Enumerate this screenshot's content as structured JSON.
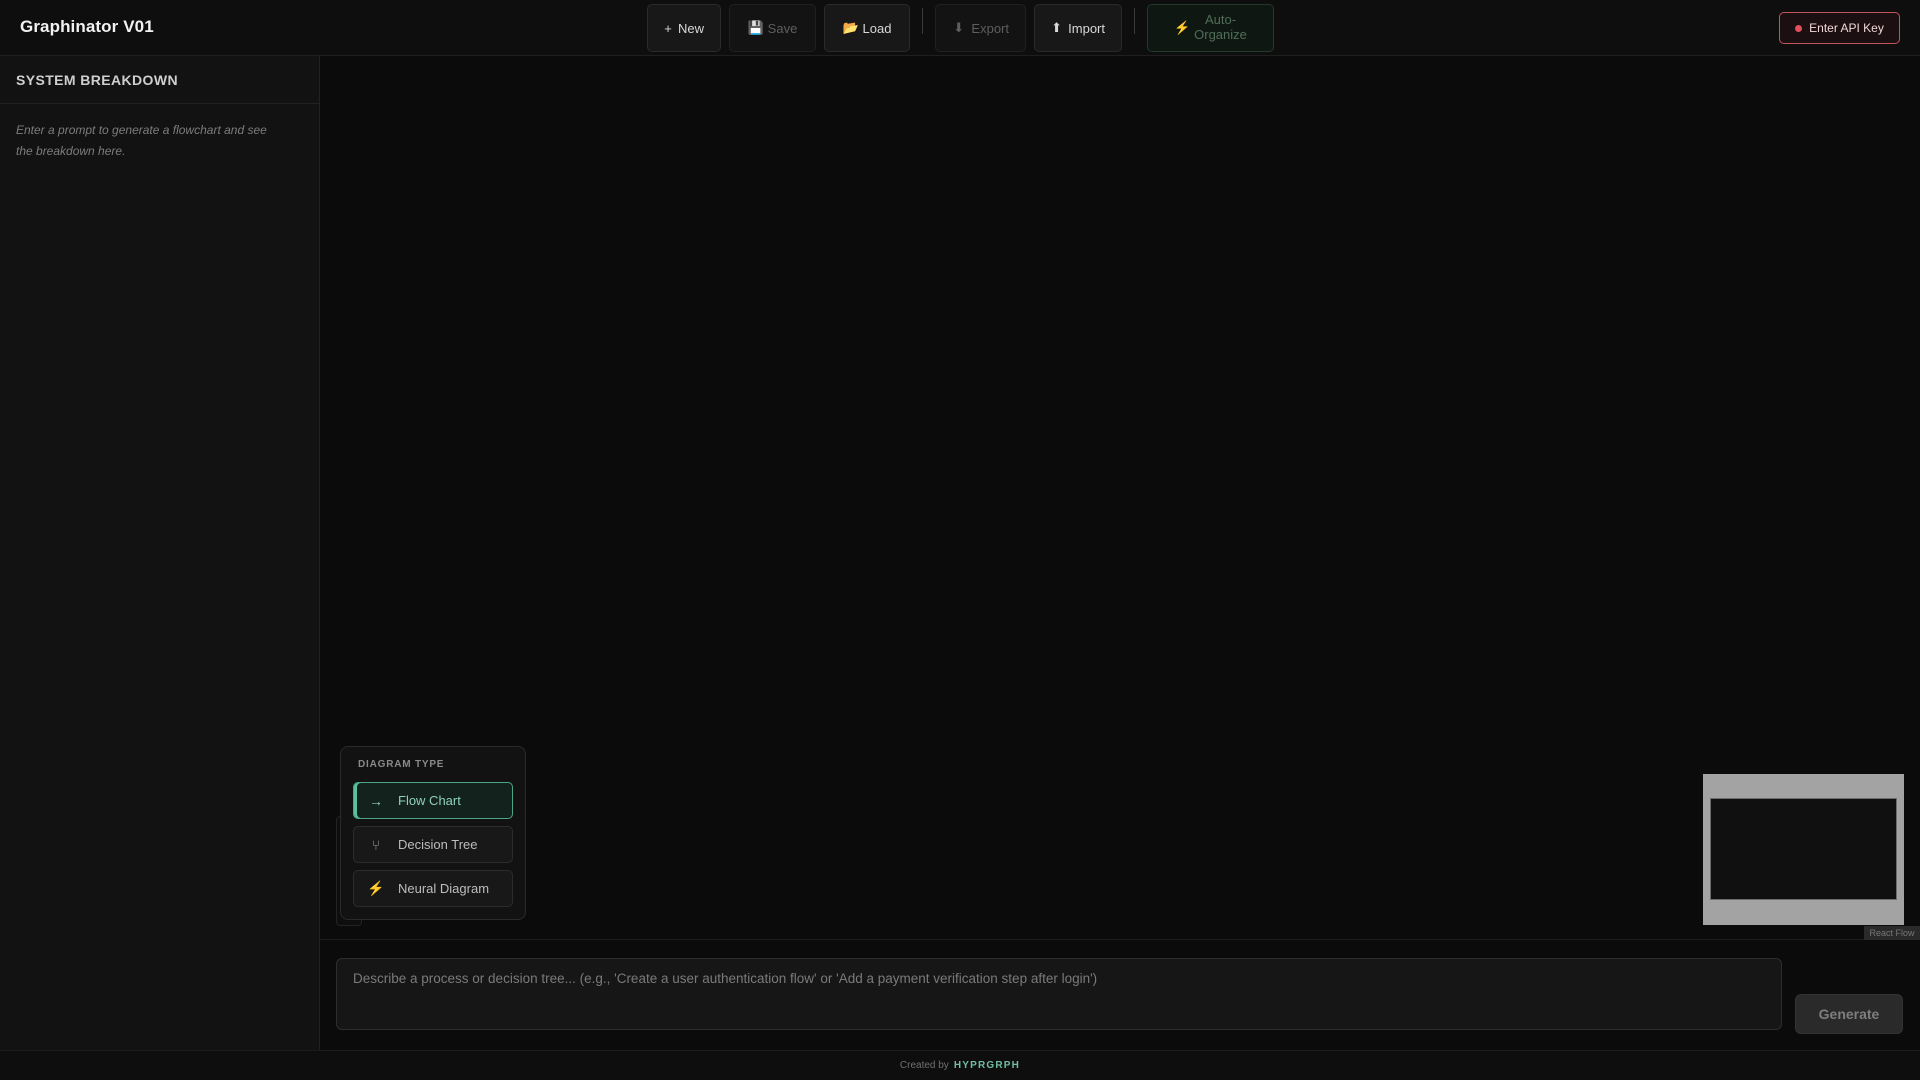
{
  "app": {
    "title": "Graphinator V01"
  },
  "toolbar": {
    "new": {
      "label": "New",
      "icon": "plus-icon",
      "glyph": "+"
    },
    "save": {
      "label": "Save",
      "icon": "floppy-icon",
      "glyph": "💾"
    },
    "load": {
      "label": "Load",
      "icon": "folder-icon",
      "glyph": "📂"
    },
    "export": {
      "label": "Export",
      "icon": "download-icon",
      "glyph": "⬇"
    },
    "import": {
      "label": "Import",
      "icon": "upload-icon",
      "glyph": "⬆"
    },
    "auto_organize": {
      "label_line1": "Auto-",
      "label_line2": "Organize",
      "icon": "lightning-icon",
      "glyph": "⚡"
    },
    "api_key": {
      "label": "Enter API Key",
      "status_color": "#e0505c"
    }
  },
  "sidebar": {
    "title": "SYSTEM BREAKDOWN",
    "hint": "Enter a prompt to generate a flowchart and see the breakdown here."
  },
  "diagram_type": {
    "title": "DIAGRAM TYPE",
    "options": [
      {
        "label": "Flow Chart",
        "icon": "arrow-right-icon",
        "glyph": "→",
        "selected": true
      },
      {
        "label": "Decision Tree",
        "icon": "branch-icon",
        "glyph": "⑂",
        "selected": false
      },
      {
        "label": "Neural Diagram",
        "icon": "lightning-icon",
        "glyph": "⚡",
        "selected": false
      }
    ]
  },
  "canvas": {
    "attribution": "React Flow"
  },
  "prompt": {
    "placeholder": "Describe a process or decision tree... (e.g., 'Create a user authentication flow' or 'Add a payment verification step after login')",
    "value": ""
  },
  "generate": {
    "label": "Generate"
  },
  "footer": {
    "prefix": "Created by",
    "brand": "HYPRGRPH"
  },
  "colors": {
    "accent": "#58c2a0",
    "danger": "#e0505c",
    "background": "#0b0b0b"
  }
}
